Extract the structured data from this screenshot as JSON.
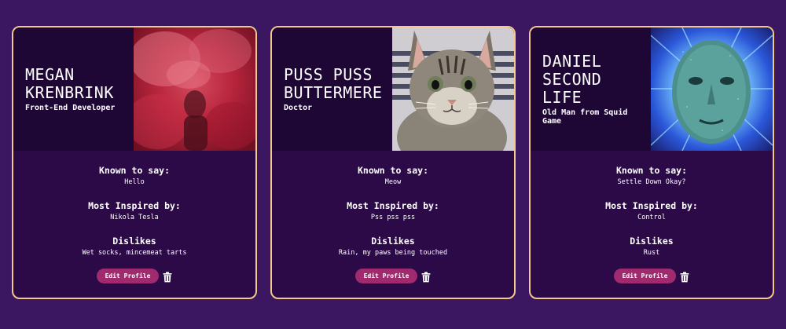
{
  "cards": [
    {
      "name": "Megan\nKrenbrink",
      "role": "Front-End Developer",
      "photo_icon": "person-in-red-smoke-photo",
      "sections": [
        {
          "title": "Known to say:",
          "value": "Hello"
        },
        {
          "title": "Most Inspired by:",
          "value": "Nikola Tesla"
        },
        {
          "title": "Dislikes",
          "value": "Wet socks, mincemeat tarts"
        }
      ],
      "edit_label": "Edit Profile"
    },
    {
      "name": "Puss Puss\nButtermere",
      "role": "Doctor",
      "photo_icon": "tabby-cat-photo",
      "sections": [
        {
          "title": "Known to say:",
          "value": "Meow"
        },
        {
          "title": "Most Inspired by:",
          "value": "Pss pss pss"
        },
        {
          "title": "Dislikes",
          "value": "Rain, my paws being touched"
        }
      ],
      "edit_label": "Edit Profile"
    },
    {
      "name": "Daniel\nSecond\nLife",
      "role": "Old Man from Squid Game",
      "photo_icon": "digital-face-photo",
      "sections": [
        {
          "title": "Known to say:",
          "value": "Settle Down Okay?"
        },
        {
          "title": "Most Inspired by:",
          "value": "Control"
        },
        {
          "title": "Dislikes",
          "value": "Rust"
        }
      ],
      "edit_label": "Edit Profile"
    }
  ],
  "colors": {
    "page_bg": "#3a1760",
    "card_bg": "#2b0a47",
    "header_bg": "#1e0735",
    "card_border": "#f2c98a",
    "button_bg": "#a02a6e"
  }
}
